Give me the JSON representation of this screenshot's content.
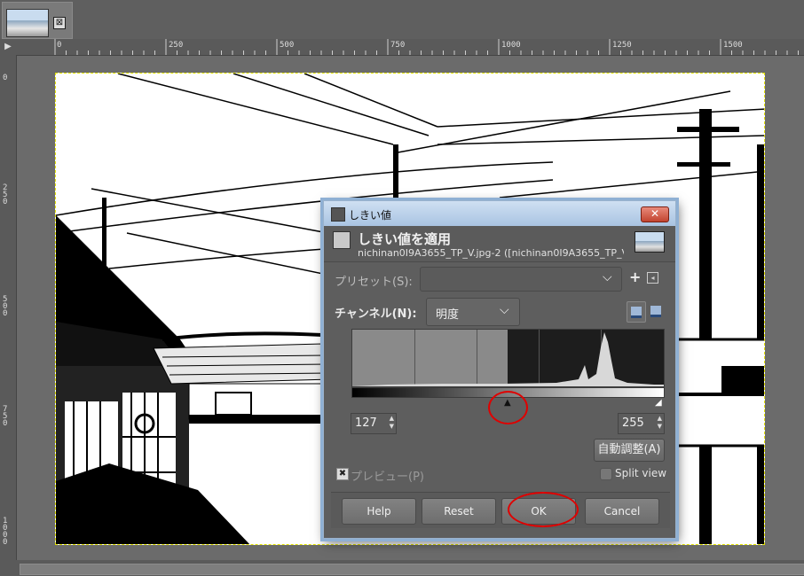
{
  "tabs": {
    "close_glyph": "⊠"
  },
  "rulers": {
    "corner_glyph": "▶",
    "h_labels": [
      "0",
      "250",
      "500",
      "750",
      "1000",
      "1250",
      "1500"
    ],
    "v_labels": [
      "0",
      "250",
      "500",
      "750",
      "1000"
    ]
  },
  "dialog": {
    "title": "しきい値",
    "close_glyph": "✕",
    "header_title": "しきい値を適用",
    "header_subtitle": "nichinan0I9A3655_TP_V.jpg-2 ([nichinan0I9A3655_TP_V] (...",
    "preset_label": "プリセット(S):",
    "preset_value": "",
    "preset_add": "+",
    "preset_menu": "◂",
    "channel_label": "チャンネル(N):",
    "channel_value": "明度",
    "chevron": "⌵",
    "slider_low_glyph": "▲",
    "slider_high_glyph": "◢",
    "low_value": "127",
    "high_value": "255",
    "spin_arrows": "▲\n▼",
    "auto_button": "自動調整(A)",
    "preview_check_glyph": "✖",
    "preview_label": "プレビュー(P)",
    "split_view_label": "Split view",
    "buttons": {
      "help": "Help",
      "reset": "Reset",
      "ok": "OK",
      "cancel": "Cancel"
    }
  },
  "colors": {
    "annotation_ring": "#e00000",
    "titlebar": "#b7cde6"
  }
}
